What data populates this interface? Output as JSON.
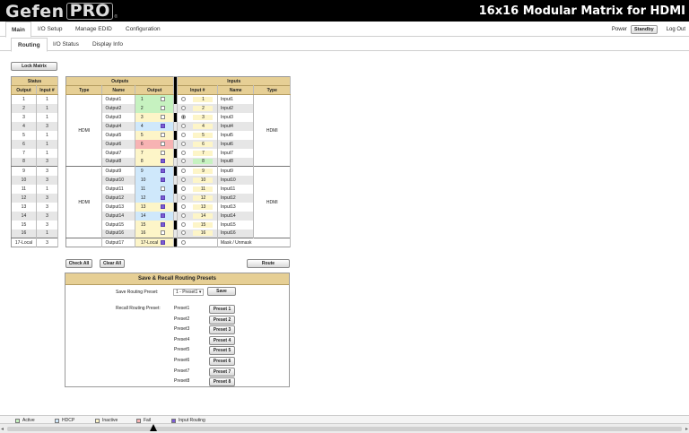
{
  "header": {
    "logo_main": "Gefen",
    "logo_pro": "PRO",
    "logo_reg": "®",
    "title": "16x16 Modular Matrix for HDMI"
  },
  "main_tabs": [
    "Main",
    "I/O Setup",
    "Manage EDID",
    "Configuration"
  ],
  "power": {
    "label": "Power",
    "standby": "Standby",
    "logout": "Log Out"
  },
  "sub_tabs": [
    "Routing",
    "I/O Status",
    "Display Info"
  ],
  "buttons": {
    "lock_matrix": "Lock Matrix",
    "check_all": "Check All",
    "clear_all": "Clear All",
    "route": "Route",
    "save": "Save"
  },
  "status": {
    "title": "Status",
    "col_output": "Output",
    "col_input": "Input #",
    "rows": [
      [
        "1",
        "1"
      ],
      [
        "2",
        "1"
      ],
      [
        "3",
        "1"
      ],
      [
        "4",
        "3"
      ],
      [
        "5",
        "1"
      ],
      [
        "6",
        "1"
      ],
      [
        "7",
        "1"
      ],
      [
        "8",
        "3"
      ],
      [
        "9",
        "3"
      ],
      [
        "10",
        "3"
      ],
      [
        "11",
        "1"
      ],
      [
        "12",
        "3"
      ],
      [
        "13",
        "3"
      ],
      [
        "14",
        "3"
      ],
      [
        "15",
        "3"
      ],
      [
        "16",
        "1"
      ],
      [
        "17-Local",
        "3"
      ]
    ]
  },
  "matrix": {
    "outputs_title": "Outputs",
    "inputs_title": "Inputs",
    "col_type": "Type",
    "col_name": "Name",
    "col_output": "Output",
    "col_input_num": "Input #",
    "group_type": "HDMI",
    "outputs": [
      {
        "name": "Output1",
        "num": "1",
        "color": "green",
        "checked": false
      },
      {
        "name": "Output2",
        "num": "2",
        "color": "green",
        "checked": false
      },
      {
        "name": "Output3",
        "num": "3",
        "color": "yellow",
        "checked": false
      },
      {
        "name": "Output4",
        "num": "4",
        "color": "blue",
        "checked": true
      },
      {
        "name": "Output5",
        "num": "5",
        "color": "yellow",
        "checked": false
      },
      {
        "name": "Output6",
        "num": "6",
        "color": "red",
        "checked": false
      },
      {
        "name": "Output7",
        "num": "7",
        "color": "yellow",
        "checked": false
      },
      {
        "name": "Output8",
        "num": "8",
        "color": "yellow",
        "checked": true
      },
      {
        "name": "Output9",
        "num": "9",
        "color": "blue",
        "checked": true
      },
      {
        "name": "Output10",
        "num": "10",
        "color": "blue",
        "checked": true
      },
      {
        "name": "Output11",
        "num": "11",
        "color": "blue",
        "checked": false
      },
      {
        "name": "Output12",
        "num": "12",
        "color": "blue",
        "checked": true
      },
      {
        "name": "Output13",
        "num": "13",
        "color": "yellow",
        "checked": true
      },
      {
        "name": "Output14",
        "num": "14",
        "color": "blue",
        "checked": true
      },
      {
        "name": "Output15",
        "num": "15",
        "color": "yellow",
        "checked": true
      },
      {
        "name": "Output16",
        "num": "16",
        "color": "yellow",
        "checked": false
      },
      {
        "name": "Output17",
        "num": "17-Local",
        "color": "yellow",
        "checked": true
      }
    ],
    "inputs": [
      {
        "num": "1",
        "name": "Input1",
        "color": "yellow",
        "selected": false
      },
      {
        "num": "2",
        "name": "Input2",
        "color": "yellow",
        "selected": false
      },
      {
        "num": "3",
        "name": "Input3",
        "color": "yellow",
        "selected": true
      },
      {
        "num": "4",
        "name": "Input4",
        "color": "yellow",
        "selected": false
      },
      {
        "num": "5",
        "name": "Input5",
        "color": "yellow",
        "selected": false
      },
      {
        "num": "6",
        "name": "Input6",
        "color": "yellow",
        "selected": false
      },
      {
        "num": "7",
        "name": "Input7",
        "color": "yellow",
        "selected": false
      },
      {
        "num": "8",
        "name": "Input8",
        "color": "green",
        "selected": false
      },
      {
        "num": "9",
        "name": "Input9",
        "color": "yellow",
        "selected": false
      },
      {
        "num": "10",
        "name": "Input10",
        "color": "yellow",
        "selected": false
      },
      {
        "num": "11",
        "name": "Input11",
        "color": "yellow",
        "selected": false
      },
      {
        "num": "12",
        "name": "Input12",
        "color": "yellow",
        "selected": false
      },
      {
        "num": "13",
        "name": "Input13",
        "color": "yellow",
        "selected": false
      },
      {
        "num": "14",
        "name": "Input14",
        "color": "yellow",
        "selected": false
      },
      {
        "num": "15",
        "name": "Input15",
        "color": "yellow",
        "selected": false
      },
      {
        "num": "16",
        "name": "Input16",
        "color": "yellow",
        "selected": false
      }
    ],
    "mask_label": "Mask / Unmask"
  },
  "presets": {
    "title": "Save & Recall Routing Presets",
    "save_label": "Save Routing Preset:",
    "save_selected": "1 - Preset1",
    "recall_label": "Recall Routing Preset:",
    "items": [
      {
        "name": "Preset1",
        "button": "Preset 1"
      },
      {
        "name": "Preset2",
        "button": "Preset 2"
      },
      {
        "name": "Preset3",
        "button": "Preset 3"
      },
      {
        "name": "Preset4",
        "button": "Preset 4"
      },
      {
        "name": "Preset5",
        "button": "Preset 5"
      },
      {
        "name": "Preset6",
        "button": "Preset 6"
      },
      {
        "name": "Preset7",
        "button": "Preset 7"
      },
      {
        "name": "Preset8",
        "button": "Preset 8"
      }
    ]
  },
  "legend": [
    {
      "label": "Active",
      "color": "#c6f2c0"
    },
    {
      "label": "HDCP",
      "color": "#cfe8fb"
    },
    {
      "label": "Inactive",
      "color": "#fdf5c8"
    },
    {
      "label": "Fail",
      "color": "#f7b3b3"
    },
    {
      "label": "Input Routing",
      "color": "#7c5cd6"
    }
  ]
}
